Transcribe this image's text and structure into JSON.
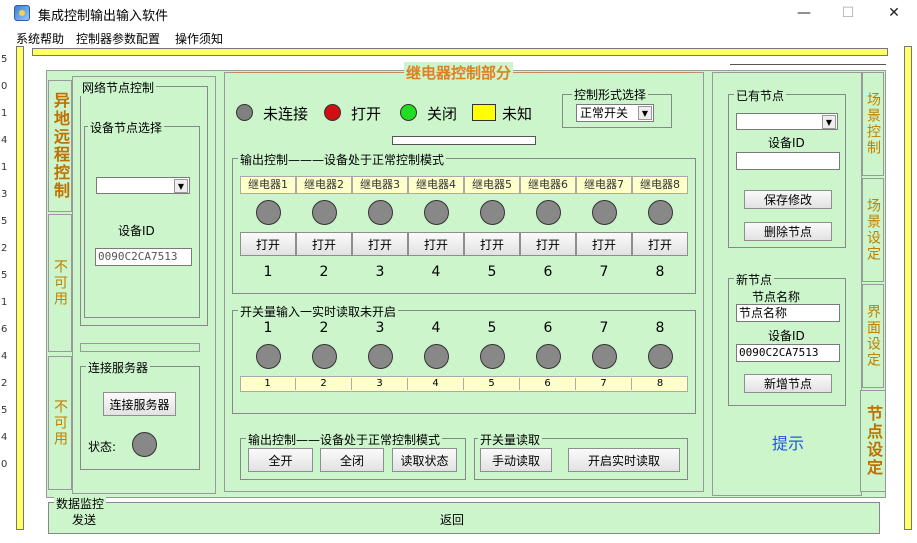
{
  "window": {
    "title": "集成控制输出输入软件",
    "minimize": "—",
    "maximize": "☐",
    "close": "✕"
  },
  "menu": {
    "items": [
      "系统帮助",
      "控制器参数配置",
      "操作须知"
    ]
  },
  "left_strip": [
    "5",
    "0",
    "1",
    "4",
    "1",
    "3",
    "5",
    "2",
    "5",
    "1",
    "6",
    "4",
    "2",
    "5",
    "4",
    "0"
  ],
  "left_tabs": [
    "异地远程控制",
    "不可用",
    "不可用"
  ],
  "network": {
    "title": "网络节点控制",
    "device_select": "设备节点选择",
    "device_id_label": "设备ID",
    "device_id_value": "0090C2CA7513"
  },
  "server": {
    "title": "连接服务器",
    "connect_button": "连接服务器",
    "status_label": "状态:"
  },
  "relay": {
    "title": "继电器控制部分",
    "legend": [
      {
        "color": "#808080",
        "label": "未连接"
      },
      {
        "color": "#d01010",
        "label": "打开"
      },
      {
        "color": "#22dd22",
        "label": "关闭"
      },
      {
        "color": "#ffff00",
        "label": "未知",
        "square": true
      }
    ],
    "mode_title": "控制形式选择",
    "mode_value": "正常开关",
    "output_title": "输出控制———设备处于正常控制模式",
    "relays": [
      "继电器1",
      "继电器2",
      "继电器3",
      "继电器4",
      "继电器5",
      "继电器6",
      "继电器7",
      "继电器8"
    ],
    "open_label": "打开",
    "numbers": [
      "1",
      "2",
      "3",
      "4",
      "5",
      "6",
      "7",
      "8"
    ],
    "input_title": "开关量输入一实时读取未开启",
    "input_numbers": [
      "1",
      "2",
      "3",
      "4",
      "5",
      "6",
      "7",
      "8"
    ]
  },
  "bottom_output": {
    "title": "输出控制——设备处于正常控制模式",
    "all_on": "全开",
    "all_off": "全闭",
    "read_status": "读取状态"
  },
  "bottom_read": {
    "title": "开关量读取",
    "manual_read": "手动读取",
    "realtime_read": "开启实时读取"
  },
  "existing_node": {
    "title": "已有节点",
    "device_id_label": "设备ID",
    "save_button": "保存修改",
    "delete_button": "删除节点"
  },
  "new_node": {
    "title": "新节点",
    "name_label": "节点名称",
    "name_value": "节点名称",
    "device_id_label": "设备ID",
    "device_id_value": "0090C2CA7513",
    "add_button": "新增节点"
  },
  "hint": "提示",
  "right_tabs": [
    "场景控制",
    "场景设定",
    "界面设定",
    "节点设定"
  ],
  "monitor": {
    "title": "数据监控",
    "send": "发送",
    "back": "返回"
  }
}
